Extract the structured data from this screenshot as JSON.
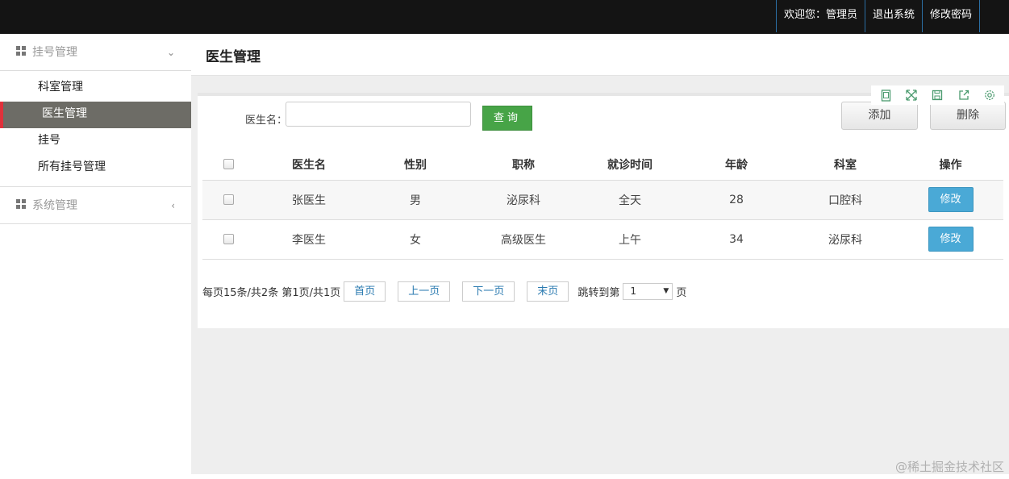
{
  "header": {
    "welcome": "欢迎您：管理员",
    "logout": "退出系统",
    "change_password": "修改密码"
  },
  "sidebar": {
    "groups": [
      {
        "label": "挂号管理",
        "icon": "grid-icon",
        "chevron": "chevron-down-icon",
        "expanded": true,
        "items": [
          {
            "label": "科室管理",
            "active": false
          },
          {
            "label": "医生管理",
            "active": true
          },
          {
            "label": "挂号",
            "active": false
          },
          {
            "label": "所有挂号管理",
            "active": false
          }
        ]
      },
      {
        "label": "系统管理",
        "icon": "grid-icon",
        "chevron": "chevron-left-icon",
        "expanded": false
      }
    ]
  },
  "page": {
    "title": "医生管理"
  },
  "search": {
    "label": "医生名：",
    "value": "",
    "placeholder": "",
    "query_button": "查询"
  },
  "actions": {
    "add": "添加",
    "delete": "删除"
  },
  "table": {
    "columns": [
      "医生名",
      "性别",
      "职称",
      "就诊时间",
      "年龄",
      "科室",
      "操作"
    ],
    "rows": [
      {
        "name": "张医生",
        "gender": "男",
        "title": "泌尿科",
        "time": "全天",
        "age": "28",
        "dept": "口腔科",
        "action": "修改"
      },
      {
        "name": "李医生",
        "gender": "女",
        "title": "高级医生",
        "time": "上午",
        "age": "34",
        "dept": "泌尿科",
        "action": "修改"
      }
    ]
  },
  "pagination": {
    "summary": "每页15条/共2条 第1页/共1页",
    "first": "首页",
    "prev": "上一页",
    "next": "下一页",
    "last": "末页",
    "jump_label": "跳转到第",
    "jump_value": "1",
    "jump_suffix": "页"
  },
  "toolbox_icons": [
    "tablet-icon",
    "fullscreen-icon",
    "save-icon",
    "export-icon",
    "settings-icon"
  ],
  "watermark": "@稀土掘金技术社区",
  "colors": {
    "topbar": "#141414",
    "active_menu": "#6d6c66",
    "active_marker": "#e0313b",
    "query_button": "#47a447",
    "edit_button": "#4aa9d6"
  }
}
